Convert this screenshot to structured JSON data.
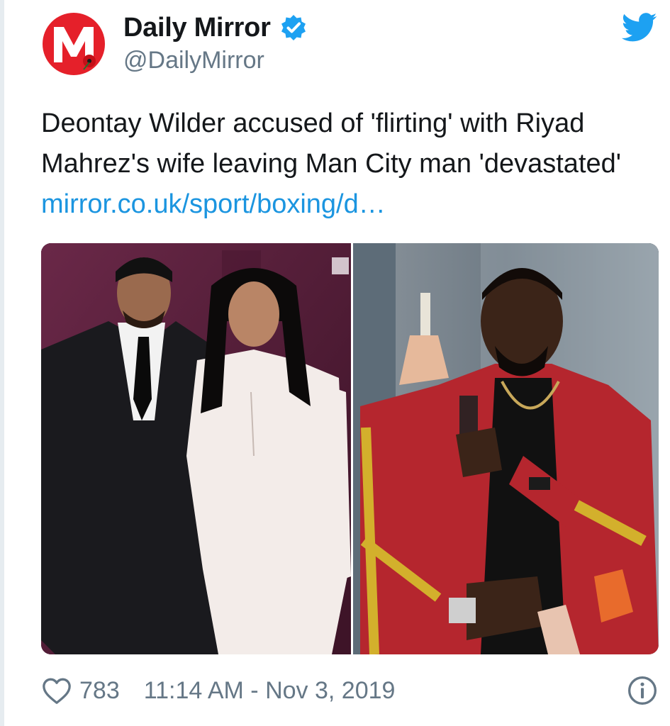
{
  "account": {
    "display_name": "Daily Mirror",
    "handle": "@DailyMirror",
    "verified": true,
    "avatar_letter": "M",
    "avatar_color": "#e5202a"
  },
  "tweet": {
    "text": "Deontay Wilder accused of 'flirting' with Riyad Mahrez's wife leaving Man City man 'devastated'",
    "link": "mirror.co.uk/sport/boxing/d…",
    "likes": "783",
    "timestamp": "11:14 AM - Nov 3, 2019"
  },
  "media": {
    "left_photo_backdrop": "#5b1f3c",
    "right_photo_backdrop": "#7a8690",
    "jacket_color": "#b5262e",
    "dress_color": "#f3ece9"
  },
  "icons": {
    "brand": "twitter-bird-icon",
    "verified": "verified-badge-icon",
    "like": "heart-icon",
    "info": "info-icon"
  },
  "colors": {
    "twitter_blue": "#1da1f2",
    "link_blue": "#1b95e0",
    "muted_text": "#657786"
  }
}
